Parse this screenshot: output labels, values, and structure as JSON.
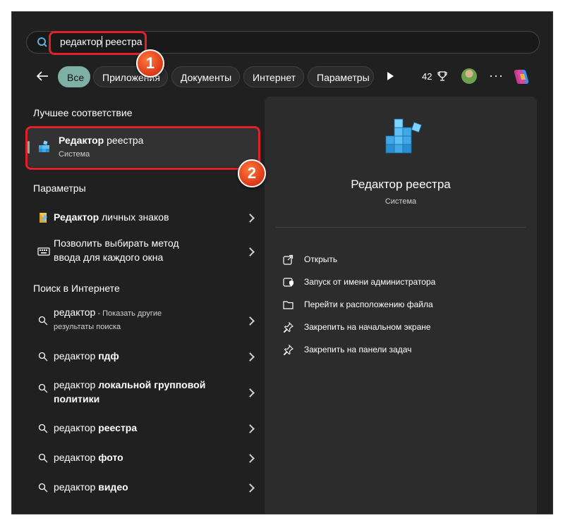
{
  "search": {
    "query_bold": "редактор",
    "query_rest": " реестра"
  },
  "filters": {
    "chips": [
      "Все",
      "Приложения",
      "Документы",
      "Интернет",
      "Параметры"
    ],
    "points": "42"
  },
  "annotations": {
    "step1": "1",
    "step2": "2"
  },
  "results": {
    "best_header": "Лучшее соответствие",
    "best": {
      "title_bold": "Редактор",
      "title_rest": " реестра",
      "subtitle": "Система"
    },
    "settings_header": "Параметры",
    "settings": [
      {
        "bold": "Редактор",
        "rest": " личных знаков"
      },
      {
        "line1": "Позволить выбирать метод",
        "line2": "ввода для каждого окна"
      }
    ],
    "web_header": "Поиск в Интернете",
    "web": [
      {
        "query": "редактор",
        "suffix": " - Показать другие",
        "line2": "результаты поиска"
      },
      {
        "query": "редактор ",
        "bold": "пдф"
      },
      {
        "query": "редактор ",
        "bold": "локальной групповой",
        "bold2": "политики"
      },
      {
        "query": "редактор ",
        "bold": "реестра"
      },
      {
        "query": "редактор ",
        "bold": "фото"
      },
      {
        "query": "редактор ",
        "bold": "видео"
      }
    ]
  },
  "details": {
    "title": "Редактор реестра",
    "subtitle": "Система",
    "actions": [
      "Открыть",
      "Запуск от имени администратора",
      "Перейти к расположению файла",
      "Закрепить на начальном экране",
      "Закрепить на панели задач"
    ]
  }
}
